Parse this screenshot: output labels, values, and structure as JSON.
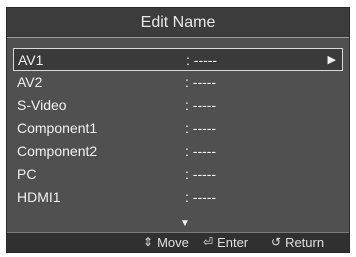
{
  "title": "Edit Name",
  "items": [
    {
      "name": "AV1",
      "value": ": -----",
      "selected": true
    },
    {
      "name": "AV2",
      "value": ": -----"
    },
    {
      "name": "S-Video",
      "value": ": -----"
    },
    {
      "name": "Component1",
      "value": ": -----"
    },
    {
      "name": "Component2",
      "value": ": -----"
    },
    {
      "name": "PC",
      "value": ": -----"
    },
    {
      "name": "HDMI1",
      "value": ": -----"
    }
  ],
  "icons": {
    "selected_arrow": "play-right-icon",
    "scroll": "chevron-down-icon",
    "move": "up-down-arrows-icon",
    "enter": "enter-icon",
    "return": "return-icon"
  },
  "footer": {
    "move_label": "Move",
    "enter_label": "Enter",
    "return_label": "Return"
  }
}
